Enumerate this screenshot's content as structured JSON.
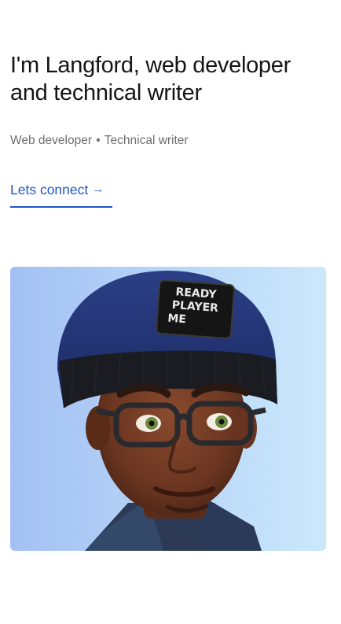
{
  "hero": {
    "headline": "I'm Langford, web developer and technical writer",
    "subtitle_role_1": "Web developer",
    "subtitle_separator": "•",
    "subtitle_role_2": "Technical writer",
    "cta_label": "Lets connect",
    "cta_icon": "arrow-right-icon"
  },
  "avatar": {
    "badge_line_1": "READY",
    "badge_line_2": "PLAYER",
    "badge_line_3": "ME"
  },
  "colors": {
    "accent": "#1e56c8",
    "text": "#151515",
    "muted": "#6d6d6d",
    "card_gradient_start": "#a3c0f3",
    "card_gradient_end": "#cbe8fb"
  }
}
